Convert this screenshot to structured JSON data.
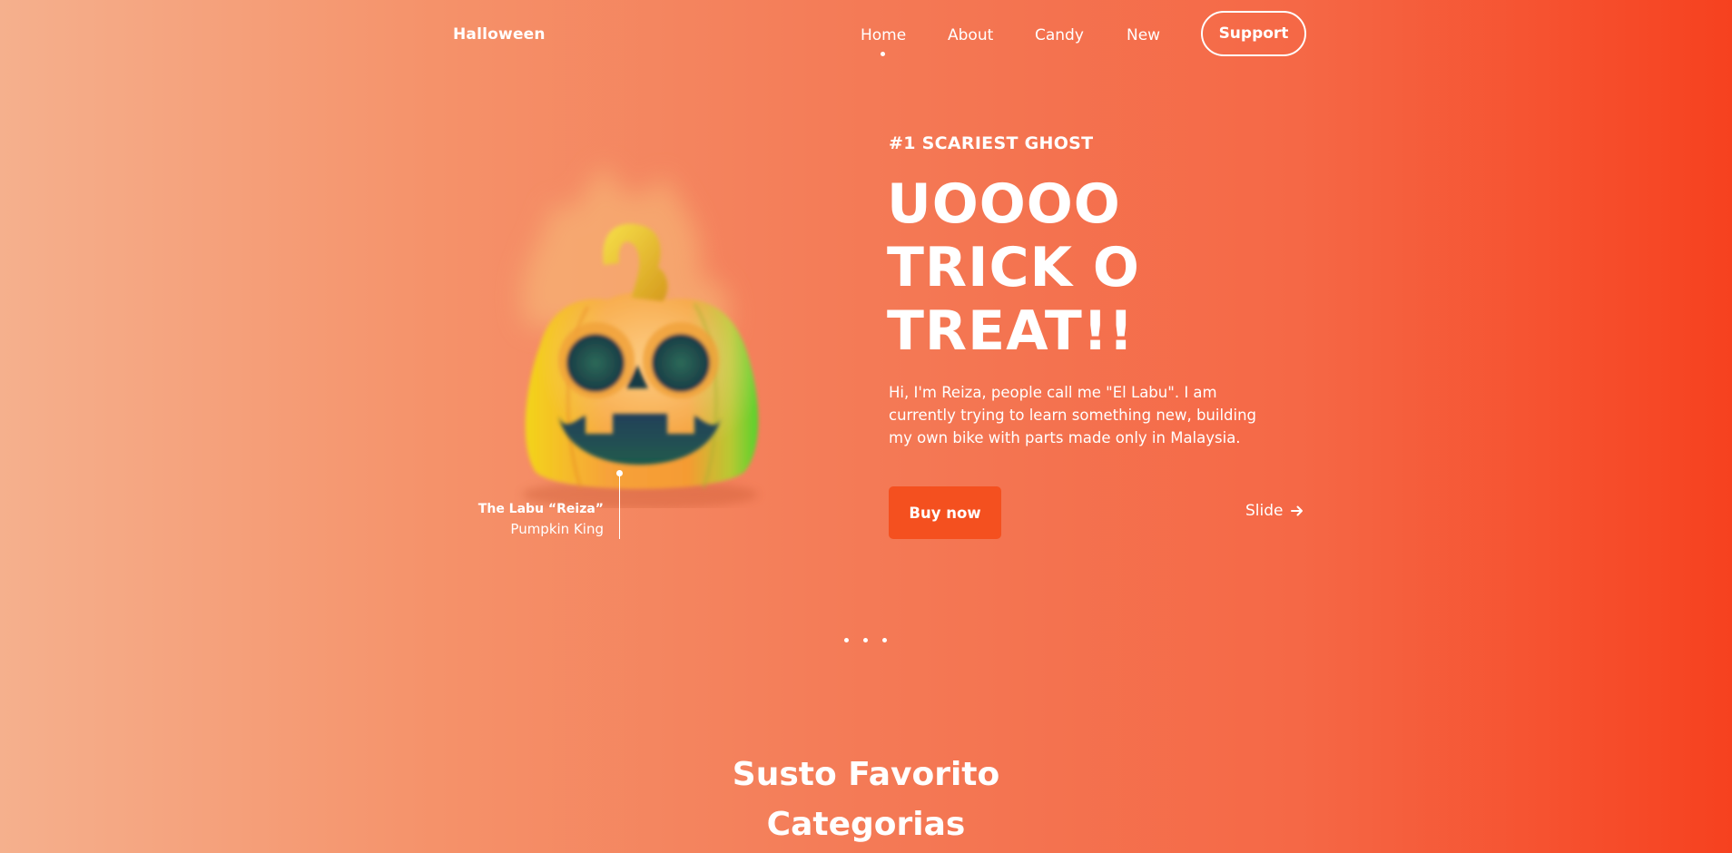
{
  "header": {
    "logo": "Halloween",
    "nav": [
      {
        "label": "Home",
        "active": true
      },
      {
        "label": "About"
      },
      {
        "label": "Candy"
      },
      {
        "label": "New"
      }
    ],
    "support_label": "Support"
  },
  "hero": {
    "eyebrow": "#1 SCARIEST GHOST",
    "headline": [
      "UOOOO",
      "TRICK O",
      "TREAT!!"
    ],
    "description": "Hi, I'm Reiza, people call me \"El Labu\". I am currently trying to learn something new, building my own bike with parts made only in Malaysia.",
    "buy_label": "Buy now",
    "slide_label": "Slide",
    "image_icon": "pumpkin-illustration",
    "caption_title": "The Labu “Reiza”",
    "caption_sub": "Pumpkin King"
  },
  "pager": {
    "count": 3,
    "active_index": 0
  },
  "section": {
    "title_line1": "Susto Favorito",
    "title_line2": "Categorias"
  },
  "colors": {
    "bg_left": "#f5b08d",
    "bg_right": "#f6411f",
    "button": "#f4501f",
    "text": "#ffffff"
  }
}
